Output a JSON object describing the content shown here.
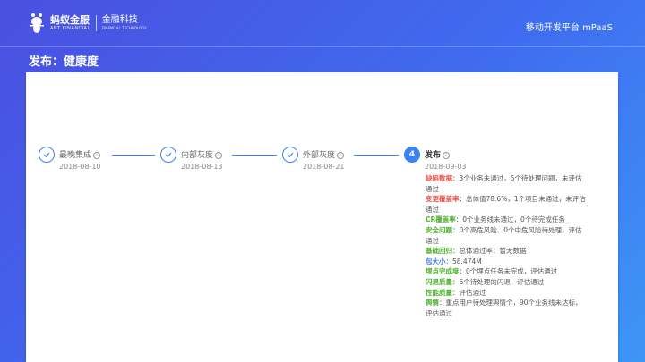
{
  "header": {
    "logo_cn": "蚂蚁金服",
    "logo_en": "ANT FINANCIAL",
    "tech_cn": "金融科技",
    "tech_en": "FINANCIAL TECHNOLOGY",
    "platform": "移动开发平台 mPaaS"
  },
  "page_title": "发布：健康度",
  "steps": [
    {
      "title": "最晚集成",
      "date": "2018-08-10",
      "status": "done"
    },
    {
      "title": "内部灰度",
      "date": "2018-08-13",
      "status": "done"
    },
    {
      "title": "外部灰度",
      "date": "2018-08-21",
      "status": "done"
    },
    {
      "title": "发布",
      "date": "2018-09-03",
      "status": "active",
      "number": "4"
    }
  ],
  "details": [
    {
      "label": "缺陷数据",
      "text": "：3个业务未通过，5个待处理问题，未评估通过",
      "color": "#e8514b"
    },
    {
      "label": "变更覆盖率",
      "text": "：总体值78.6%，1个项目未通过，未评估通过",
      "color": "#e8514b"
    },
    {
      "label": "CR覆盖率",
      "text": "：0个业务线未通过，0个待完成任务",
      "color": "#52b030"
    },
    {
      "label": "安全问题",
      "text": "：0个高危风险、0个中危风险待处理，评估通过",
      "color": "#52b030"
    },
    {
      "label": "基础回归",
      "text": "：总体通过率：暂无数据",
      "color": "#52b030"
    },
    {
      "label": "包大小",
      "text": "：58.474M",
      "color": "#3b82f6"
    },
    {
      "label": "埋点完成度",
      "text": "：0个埋点任务未完成，评估通过",
      "color": "#52b030"
    },
    {
      "label": "闪退质量",
      "text": "：6个待处理的闪退，评估通过",
      "color": "#52b030"
    },
    {
      "label": "性能质量",
      "text": "：评估通过",
      "color": "#52b030"
    },
    {
      "label": "舆情",
      "text": "：重点用户待处理舆情个，90个业务线未达标，评估通过",
      "color": "#52b030"
    }
  ]
}
